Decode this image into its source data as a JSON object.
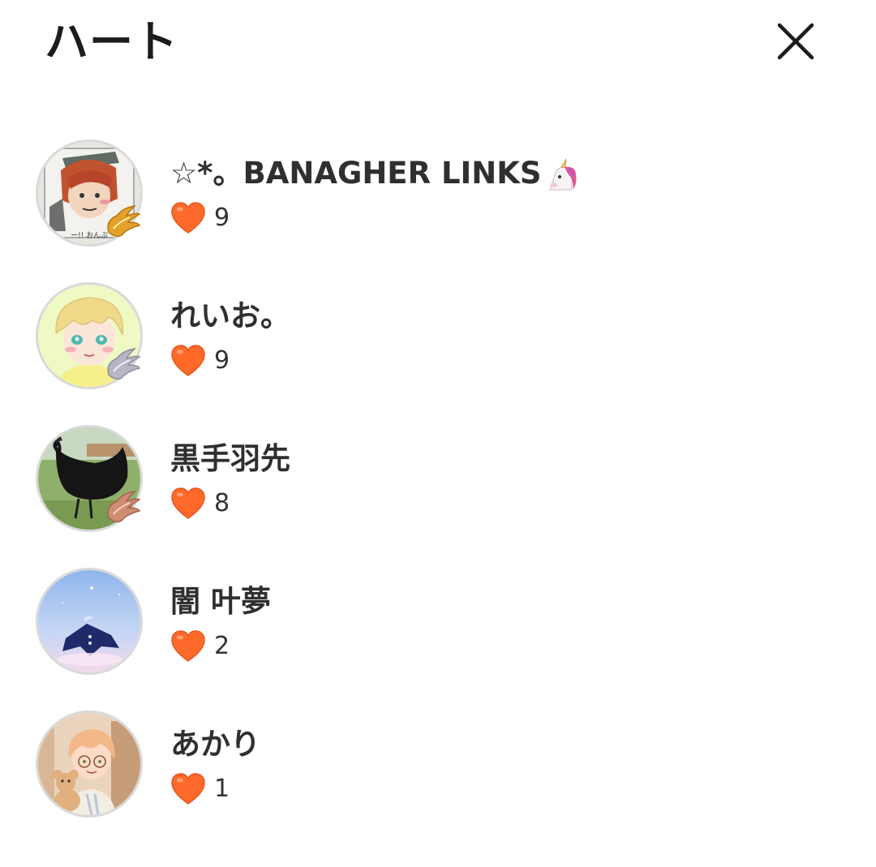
{
  "header": {
    "title": "ハート",
    "close_icon": "close-icon"
  },
  "colors": {
    "heart": "#ff6a2b",
    "heart_outline": "#e8551c",
    "text": "#2f2f2f",
    "avatar_border": "#d9d9d9"
  },
  "users": [
    {
      "name": "☆*。BANAGHER LINKS",
      "name_emoji": "unicorn-icon",
      "hearts": "9",
      "avatar": "drawn-red-haired-character-avatar",
      "badge": "gold-wing-badge-icon"
    },
    {
      "name": "れいお。",
      "hearts": "9",
      "avatar": "blonde-anime-boy-avatar",
      "badge": "silver-wing-badge-icon"
    },
    {
      "name": "黒手羽先",
      "hearts": "8",
      "avatar": "black-rooster-photo-avatar",
      "badge": "copper-wing-badge-icon"
    },
    {
      "name": "闇 叶夢",
      "hearts": "2",
      "avatar": "starry-sky-figure-avatar"
    },
    {
      "name": "あかり",
      "hearts": "1",
      "avatar": "anime-boy-with-teddy-bear-avatar"
    }
  ]
}
